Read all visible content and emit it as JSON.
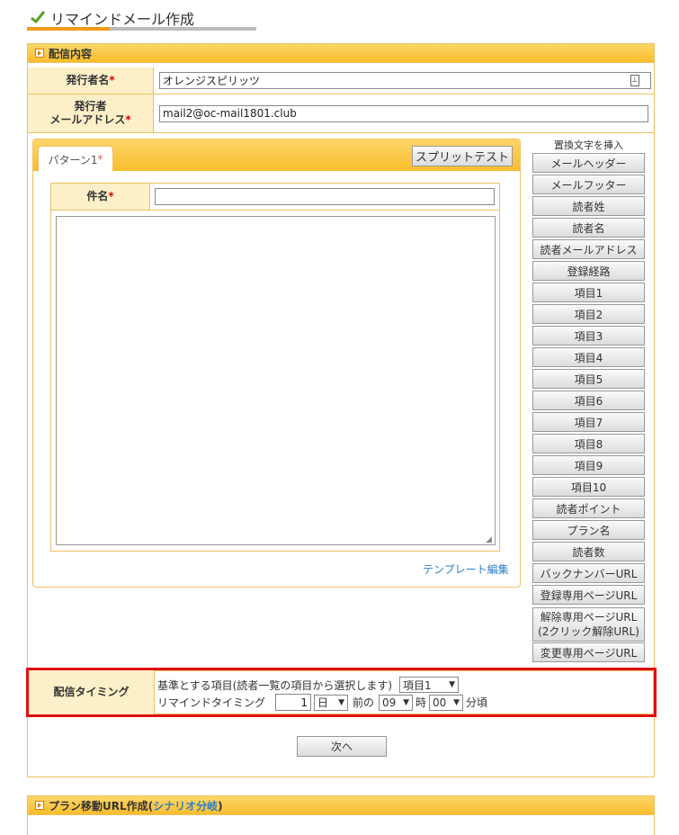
{
  "page": {
    "title": "リマインドメール作成"
  },
  "content_section": {
    "header": "配信内容"
  },
  "sender_name": {
    "label": "発行者名",
    "value": "オレンジスピリッツ"
  },
  "sender_email": {
    "label_line1": "発行者",
    "label_line2": "メールアドレス",
    "value": "mail2@oc-mail1801.club"
  },
  "pattern": {
    "tab_label": "パターン1",
    "split_test_button": "スプリットテスト"
  },
  "subject": {
    "label": "件名",
    "value": ""
  },
  "body": {
    "value": ""
  },
  "template_edit_link": "テンプレート編集",
  "insert_panel": {
    "heading": "置換文字を挿入",
    "buttons": [
      "メールヘッダー",
      "メールフッター",
      "読者姓",
      "読者名",
      "読者メールアドレス",
      "登録経路",
      "項目1",
      "項目2",
      "項目3",
      "項目4",
      "項目5",
      "項目6",
      "項目7",
      "項目8",
      "項目9",
      "項目10",
      "読者ポイント",
      "プラン名",
      "読者数",
      "バックナンバーURL",
      "登録専用ページURL"
    ],
    "unsubscribe_line1": "解除専用ページURL",
    "unsubscribe_line2": "(2クリック解除URL)",
    "change_page": "変更専用ページURL"
  },
  "timing": {
    "label": "配信タイミング",
    "base_item_text": "基準とする項目(読者一覧の項目から選択します)",
    "base_item_value": "項目1",
    "remind_label": "リマインドタイミング",
    "amount": "1",
    "unit": "日",
    "before": "前の",
    "hour": "09",
    "hour_suffix": "時",
    "minute": "00",
    "minute_suffix": "分頃"
  },
  "next_button": "次へ",
  "plan_section": {
    "header_prefix": "プラン移動URL作成(",
    "header_link": "シナリオ分岐",
    "header_suffix": ")"
  },
  "colors": {
    "accent": "#f8bd2b",
    "label_bg": "#fdf0c8",
    "highlight": "#e01010",
    "link": "#2a7ec8"
  }
}
